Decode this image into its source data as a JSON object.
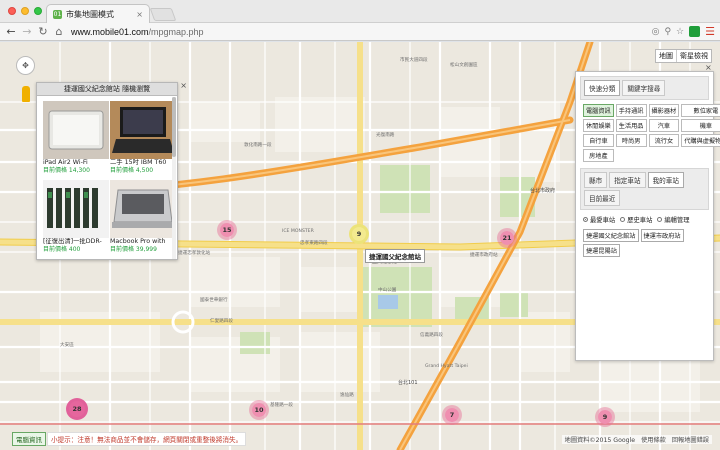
{
  "browser": {
    "tab_title": "市集地圖模式",
    "tab_close": "×",
    "url_host": "www.mobile01.com",
    "url_path": "/mpgmap.php"
  },
  "map": {
    "type_controls": [
      "地圖",
      "衛星檢視"
    ],
    "labels": [
      {
        "text": "台北市政府",
        "cls": "dark"
      },
      {
        "text": "國父紀念館",
        "cls": "dark"
      },
      {
        "text": "中山公園",
        "cls": ""
      },
      {
        "text": "捷運忠孝敦化站",
        "cls": ""
      },
      {
        "text": "捷運市政府站",
        "cls": ""
      },
      {
        "text": "忠孝東路四段",
        "cls": ""
      },
      {
        "text": "仁愛路四段",
        "cls": ""
      },
      {
        "text": "光復南路",
        "cls": ""
      },
      {
        "text": "逸仙路",
        "cls": ""
      },
      {
        "text": "市民大道四段",
        "cls": ""
      },
      {
        "text": "基隆路一段",
        "cls": ""
      },
      {
        "text": "信義路四段",
        "cls": ""
      },
      {
        "text": "Grand Hyatt Taipei",
        "cls": ""
      },
      {
        "text": "台北101",
        "cls": "dark"
      },
      {
        "text": "延吉街",
        "cls": ""
      },
      {
        "text": "敦化南路一段",
        "cls": ""
      },
      {
        "text": "ICE MONSTER",
        "cls": ""
      },
      {
        "text": "國泰世華銀行",
        "cls": ""
      },
      {
        "text": "松山文創園區",
        "cls": ""
      },
      {
        "text": "大安區",
        "cls": ""
      }
    ],
    "clusters": [
      {
        "count": "15",
        "style": "pink"
      },
      {
        "count": "9",
        "style": "yellow"
      },
      {
        "count": "21",
        "style": "pink"
      },
      {
        "count": "28",
        "style": "magenta"
      },
      {
        "count": "10",
        "style": "pink"
      },
      {
        "count": "7",
        "style": "pink"
      },
      {
        "count": "9",
        "style": "pink"
      }
    ],
    "place_tag": "捷運國父紀念館站"
  },
  "info_window": {
    "title": "捷運國父紀念館站 隨機瀏覽",
    "products": [
      {
        "name": "iPad Air2 Wi-Fi",
        "price": "目前價格 14,300"
      },
      {
        "name": "二手 15吋 IBM T60",
        "price": "目前價格 4,500"
      },
      {
        "name": "[征復出清]一批DDR-",
        "price": "目前價格 400"
      },
      {
        "name": "Macbook Pro with",
        "price": "目前價格 39,999"
      }
    ]
  },
  "panel": {
    "top_tabs": [
      "快速分類",
      "關鍵字搜尋"
    ],
    "categories": [
      "電腦資訊",
      "手持通訊",
      "攝影器材",
      "數位家電",
      "休閒娛樂",
      "生活用品",
      "汽車",
      "機車",
      "自行車",
      "時尚男",
      "流行女",
      "代購與虛擬物品",
      "房地產"
    ],
    "selected_category": "電腦資訊",
    "store_tabs": [
      "縣市",
      "指定車站",
      "我的車站",
      "目前最近"
    ],
    "active_store_tab": "我的車站",
    "radios": [
      {
        "label": "最愛車站",
        "checked": true
      },
      {
        "label": "歷史車站",
        "checked": false
      },
      {
        "label": "編輯管理",
        "checked": false
      }
    ],
    "stations": [
      "捷運國父紀念館站",
      "捷運市政府站",
      "捷運昆陽站"
    ]
  },
  "bottom": {
    "category_badge": "電腦資訊",
    "notice": "小提示：注意！無法商品並不會儲存，網頁關閉或重整後將消失。",
    "attribution": [
      "地圖資料©2015 Google",
      "使用條款",
      "回報地圖錯誤"
    ]
  }
}
